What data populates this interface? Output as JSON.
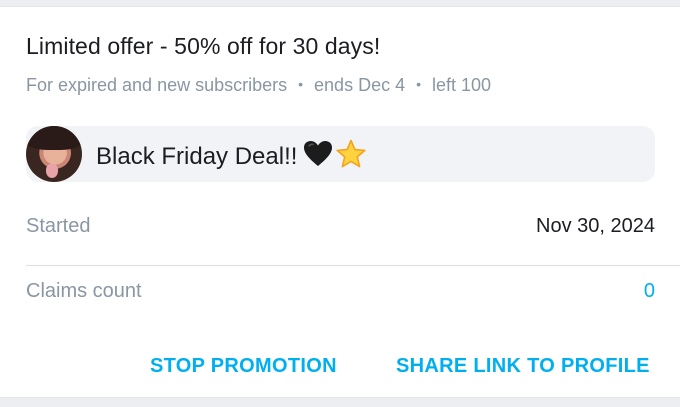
{
  "promo": {
    "title": "Limited offer - 50% off for 30 days!",
    "audience": "For expired and new subscribers",
    "ends": "ends Dec 4",
    "left": "left 100",
    "separator": "•",
    "message": "Black Friday Deal!!",
    "emojis": [
      "black-heart",
      "star"
    ]
  },
  "details": {
    "started_label": "Started",
    "started_value": "Nov 30, 2024",
    "claims_label": "Claims count",
    "claims_value": "0"
  },
  "actions": {
    "stop_label": "STOP PROMOTION",
    "share_label": "SHARE LINK TO PROFILE"
  },
  "colors": {
    "accent": "#00aff0",
    "muted": "#8a96a3",
    "text": "#1b1d22",
    "message_bg": "#f1f3f6"
  }
}
